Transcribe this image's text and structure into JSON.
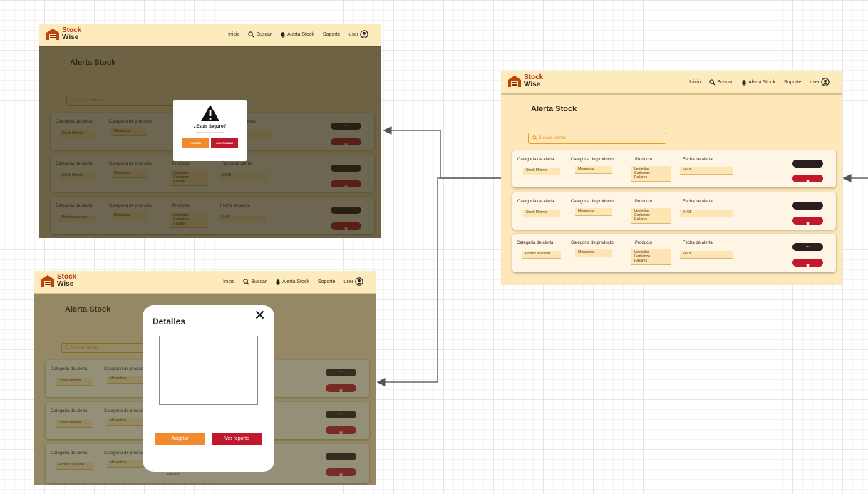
{
  "app": {
    "brand_line1": "Stock",
    "brand_line2": "Wise"
  },
  "nav": {
    "inicio": "Inicio",
    "buscar": "Buscar",
    "alerta": "Alerta Stock",
    "soporte": "Soporte",
    "user": "user"
  },
  "icons": {
    "logo": "warehouse-icon",
    "search": "search-icon",
    "bell": "bell-icon",
    "user": "user-circle-icon",
    "trash": "trash-icon",
    "close": "close-icon",
    "warning": "warning-icon"
  },
  "page": {
    "title": "Alerta Stock",
    "search_placeholder": "Buscar Alertas"
  },
  "labels": {
    "categoria": "Categoría de alerta",
    "categoria_producto": "Categoría de producto",
    "producto": "Producto",
    "fecha": "Fecha de alerta",
    "more": "...",
    "more_dots": "..."
  },
  "alerts": [
    {
      "categoria": "Stock Mínimo",
      "categoria_producto": "Menestras",
      "productos": [
        "Lentejitas",
        "Garbanzo",
        "Pallares"
      ],
      "fecha": "24/05"
    },
    {
      "categoria": "Stock Mínimo",
      "categoria_producto": "Menestras",
      "productos": [
        "Lentejitas",
        "Garbanzo",
        "Pallares"
      ],
      "fecha": "24/05"
    },
    {
      "categoria": "Pronto a vencer",
      "categoria_producto": "Menestras",
      "productos": [
        "Lentejitas",
        "Garbanzo",
        "Pallares"
      ],
      "fecha": "24/05"
    }
  ],
  "confirm_modal": {
    "title": "¿Estás Seguro?",
    "subtitle": "¿Desea eliminar esta alerta?",
    "back": "VOLVER",
    "continue": "CONTINUAR"
  },
  "details_modal": {
    "title": "Detalles",
    "accept": "Aceptar",
    "report": "Ver reporte"
  },
  "colors": {
    "background": "#fee8ba",
    "accent_orange": "#f08a2c",
    "danger_red": "#c0182d",
    "dark_button": "#2a1e1e",
    "brand": "#b33a10"
  }
}
